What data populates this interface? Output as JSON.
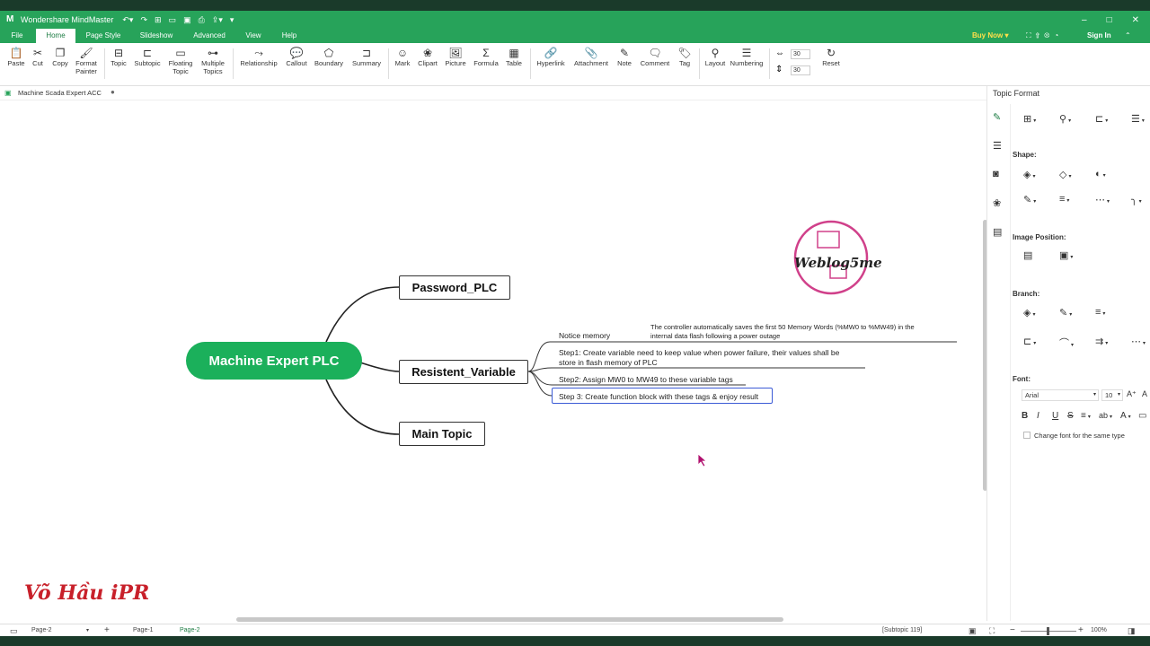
{
  "app": {
    "title": "Wondershare MindMaster",
    "window_controls": [
      "–",
      "□",
      "✕"
    ]
  },
  "menu": {
    "tabs": [
      "File",
      "Home",
      "Page Style",
      "Slideshow",
      "Advanced",
      "View",
      "Help"
    ],
    "active": "Home",
    "buy_now": "Buy Now",
    "sign_in": "Sign In"
  },
  "ribbon": {
    "buttons": [
      {
        "label": "Paste",
        "icon": "paste-icon"
      },
      {
        "label": "Cut",
        "icon": "cut-icon"
      },
      {
        "label": "Copy",
        "icon": "copy-icon"
      },
      {
        "label": "Format Painter",
        "icon": "format-painter-icon"
      },
      {
        "label": "Topic",
        "icon": "topic-icon"
      },
      {
        "label": "Subtopic",
        "icon": "subtopic-icon"
      },
      {
        "label": "Floating Topic",
        "icon": "floating-topic-icon"
      },
      {
        "label": "Multiple Topics",
        "icon": "multiple-topics-icon"
      },
      {
        "label": "Relationship",
        "icon": "relationship-icon"
      },
      {
        "label": "Callout",
        "icon": "callout-icon"
      },
      {
        "label": "Boundary",
        "icon": "boundary-icon"
      },
      {
        "label": "Summary",
        "icon": "summary-icon"
      },
      {
        "label": "Mark",
        "icon": "mark-icon"
      },
      {
        "label": "Clipart",
        "icon": "clipart-icon"
      },
      {
        "label": "Picture",
        "icon": "picture-icon"
      },
      {
        "label": "Formula",
        "icon": "formula-icon"
      },
      {
        "label": "Table",
        "icon": "table-icon"
      },
      {
        "label": "Hyperlink",
        "icon": "hyperlink-icon"
      },
      {
        "label": "Attachment",
        "icon": "attachment-icon"
      },
      {
        "label": "Note",
        "icon": "note-icon"
      },
      {
        "label": "Comment",
        "icon": "comment-icon"
      },
      {
        "label": "Tag",
        "icon": "tag-icon"
      },
      {
        "label": "Layout",
        "icon": "layout-icon"
      },
      {
        "label": "Numbering",
        "icon": "numbering-icon"
      },
      {
        "label": "Reset",
        "icon": "reset-icon"
      }
    ],
    "spacing_h": "30",
    "spacing_v": "30"
  },
  "document_tab": "Machine Scada Expert ACC",
  "mindmap": {
    "central": "Machine Expert PLC",
    "topics": [
      "Password_PLC",
      "Resistent_Variable",
      "Main Topic"
    ],
    "subtopics": {
      "notice": "Notice memory",
      "notice_detail_1": "The controller automatically saves the first 50 Memory Words (%MW0 to %MW49) in the",
      "notice_detail_2": "internal data flash following a power outage",
      "step1_line1": "Step1: Create variable need to keep value when power failure, their values shall be",
      "step1_line2": "store in flash memory of PLC",
      "step2": "Step2: Assign MW0 to MW49 to these variable tags",
      "step3": "Step 3: Create function block with these tags & enjoy result"
    }
  },
  "watermarks": {
    "logo": "Weblog5me",
    "signature": "Võ Hầu iPR"
  },
  "panel": {
    "title": "Topic Format",
    "shape_label": "Shape:",
    "image_position_label": "Image Position:",
    "branch_label": "Branch:",
    "font_label": "Font:",
    "font_name": "Arial",
    "font_size": "10",
    "change_font_label": "Change font for the same type"
  },
  "status": {
    "page_select": "Page-2",
    "pages": [
      "Page-1",
      "Page-2"
    ],
    "active_page": "Page-2",
    "selection": "[Subtopic 119]",
    "zoom": "100%"
  },
  "colors": {
    "brand_green": "#27a35a",
    "central_green": "#1bb05b",
    "selection_blue": "#3b5bd6",
    "logo_magenta": "#d0408a",
    "signature_red": "#c8202a"
  }
}
